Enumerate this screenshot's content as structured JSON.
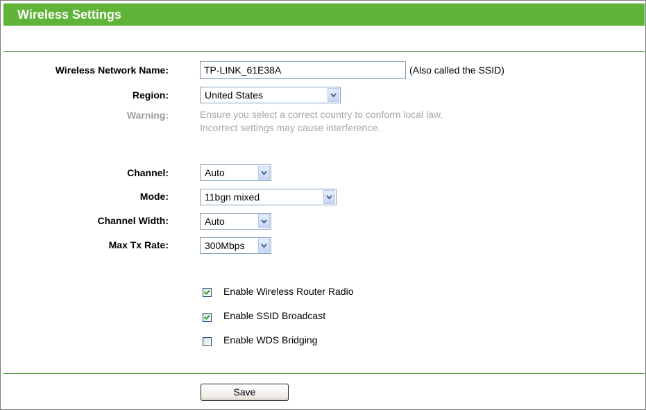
{
  "header": {
    "title": "Wireless Settings"
  },
  "form": {
    "network_name": {
      "label": "Wireless Network Name:",
      "value": "TP-LINK_61E38A",
      "hint": "(Also called the SSID)"
    },
    "region": {
      "label": "Region:",
      "value": "United States"
    },
    "warning": {
      "label": "Warning:",
      "line1": "Ensure you select a correct country to conform local law.",
      "line2": "Incorrect settings may cause interference."
    },
    "channel": {
      "label": "Channel:",
      "value": "Auto"
    },
    "mode": {
      "label": "Mode:",
      "value": "11bgn mixed"
    },
    "channel_width": {
      "label": "Channel Width:",
      "value": "Auto"
    },
    "max_tx_rate": {
      "label": "Max Tx Rate:",
      "value": "300Mbps"
    },
    "checkboxes": [
      {
        "label": "Enable Wireless Router Radio",
        "checked": true
      },
      {
        "label": "Enable SSID Broadcast",
        "checked": true
      },
      {
        "label": "Enable WDS Bridging",
        "checked": false
      }
    ]
  },
  "actions": {
    "save_label": "Save"
  },
  "colors": {
    "header_bg": "#5fb337",
    "warning_text": "#a6a6a6",
    "checkmark": "#22a022"
  },
  "icons": {
    "dropdown": "chevron-down-icon",
    "check": "checkmark-icon"
  }
}
